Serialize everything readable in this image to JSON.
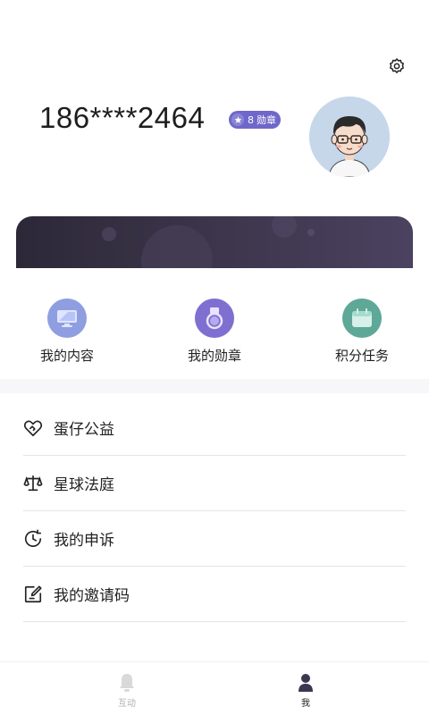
{
  "header": {
    "phone": "186****2464",
    "medal_count": "8",
    "medal_label": "勋章",
    "settings_icon": "gear-icon"
  },
  "colors": {
    "badge": "#6f67c9",
    "banner": "#3b3449",
    "content_icon": "#8e9ee0",
    "medal_icon": "#7f6fd0",
    "task_icon": "#5ea898"
  },
  "quick_actions": [
    {
      "label": "我的内容",
      "icon": "monitor-icon"
    },
    {
      "label": "我的勋章",
      "icon": "medal-icon"
    },
    {
      "label": "积分任务",
      "icon": "calendar-icon"
    }
  ],
  "menu": [
    {
      "label": "蛋仔公益",
      "icon": "heart-hands-icon"
    },
    {
      "label": "星球法庭",
      "icon": "scales-icon"
    },
    {
      "label": "我的申诉",
      "icon": "clock-icon"
    },
    {
      "label": "我的邀请码",
      "icon": "edit-note-icon"
    }
  ],
  "tabbar": [
    {
      "label": "互动",
      "icon": "bell-icon",
      "active": false
    },
    {
      "label": "我",
      "icon": "person-icon",
      "active": true
    }
  ]
}
